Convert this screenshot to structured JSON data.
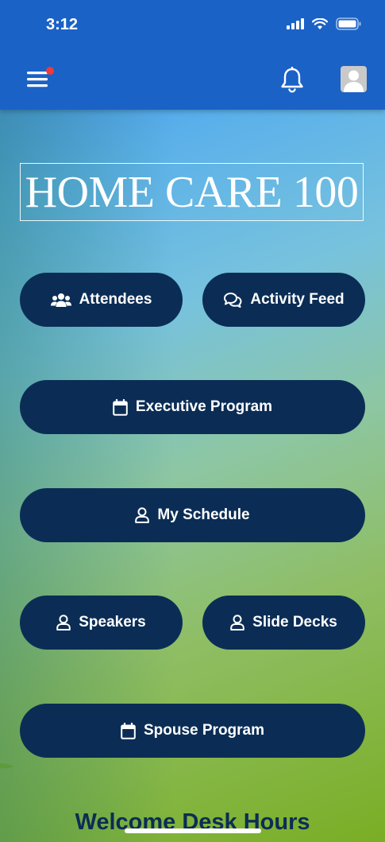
{
  "status_bar": {
    "time": "3:12"
  },
  "header": {
    "menu_icon": "hamburger-menu-icon",
    "notification_icon": "bell-icon",
    "profile_icon": "user-avatar-icon",
    "badge_color": "#f03a3a",
    "bar_color": "#1b62c6"
  },
  "logo": {
    "text": "HOME CARE 100"
  },
  "buttons": {
    "attendees": {
      "label": "Attendees",
      "icon": "users-icon"
    },
    "activity_feed": {
      "label": "Activity Feed",
      "icon": "chat-bubbles-icon"
    },
    "executive_program": {
      "label": "Executive Program",
      "icon": "calendar-icon"
    },
    "my_schedule": {
      "label": "My Schedule",
      "icon": "user-icon"
    },
    "speakers": {
      "label": "Speakers",
      "icon": "user-icon"
    },
    "slide_decks": {
      "label": "Slide Decks",
      "icon": "user-icon"
    },
    "spouse_program": {
      "label": "Spouse Program",
      "icon": "calendar-icon"
    }
  },
  "button_color": "#0b2d55",
  "welcome": {
    "title": "Welcome Desk Hours"
  }
}
